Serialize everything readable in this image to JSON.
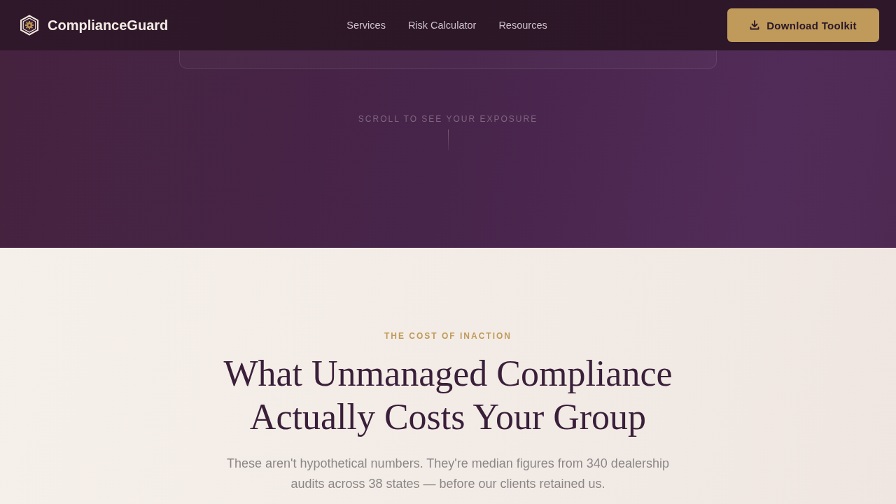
{
  "header": {
    "brand": "ComplianceGuard",
    "nav": [
      {
        "label": "Services"
      },
      {
        "label": "Risk Calculator"
      },
      {
        "label": "Resources"
      }
    ],
    "cta": {
      "label": "Download Toolkit"
    }
  },
  "hero": {
    "scroll_hint": "SCROLL TO SEE YOUR EXPOSURE"
  },
  "section": {
    "eyebrow": "THE COST OF INACTION",
    "heading": "What Unmanaged Compliance Actually Costs Your Group",
    "intro": "These aren't hypothetical numbers. They're median figures from 340 dealership audits across 38 states — before our clients retained us."
  }
}
